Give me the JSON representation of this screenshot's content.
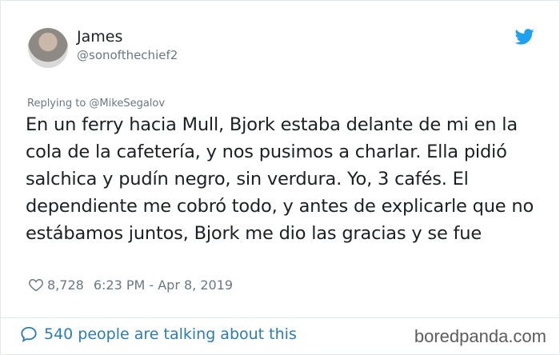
{
  "tweet": {
    "author_name": "James",
    "author_handle": "@sonofthechief2",
    "reply_to": "Replying to @MikeSegalov",
    "text": "En un ferry hacia Mull, Bjork estaba delante de mi en la cola de la cafetería, y nos pusimos a charlar. Ella pidió salchica y pudín negro, sin verdura. Yo, 3 cafés. El dependiente me cobró todo, y antes de explicarle que no estábamos juntos, Bjork me dio las gracias y se fue",
    "likes": "8,728",
    "timestamp": "6:23 PM - Apr 8, 2019",
    "talking": "540 people are talking about this"
  },
  "footer": {
    "watermark": "boredpanda.com"
  },
  "colors": {
    "text": "#1c2022",
    "muted": "#697882",
    "link": "#2b7bb9",
    "twitter_blue": "#1da1f2",
    "border": "#e1e8ed"
  },
  "icons": [
    "twitter-bird-icon",
    "heart-icon",
    "comment-bubble-icon"
  ]
}
